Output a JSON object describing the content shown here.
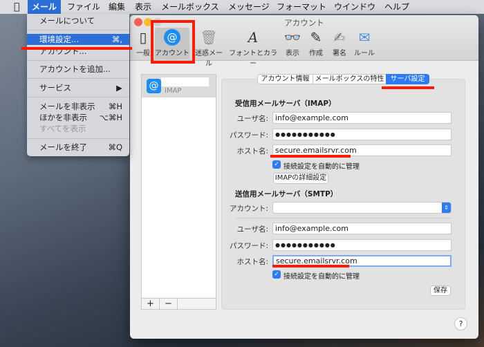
{
  "menubar": {
    "items": [
      "メール",
      "ファイル",
      "編集",
      "表示",
      "メールボックス",
      "メッセージ",
      "フォーマット",
      "ウインドウ",
      "ヘルプ"
    ]
  },
  "menu": {
    "items": [
      {
        "label": "メールについて",
        "shortcut": ""
      },
      {
        "label": "環境設定...",
        "shortcut": "⌘,"
      },
      {
        "label": "アカウント...",
        "shortcut": ""
      },
      {
        "label": "アカウントを追加...",
        "shortcut": ""
      },
      {
        "label": "サービス",
        "shortcut": "▶"
      },
      {
        "label": "メールを非表示",
        "shortcut": "⌘H"
      },
      {
        "label": "ほかを非表示",
        "shortcut": "⌥⌘H"
      },
      {
        "label": "すべてを表示",
        "shortcut": ""
      },
      {
        "label": "メールを終了",
        "shortcut": "⌘Q"
      }
    ]
  },
  "window": {
    "title": "アカウント",
    "toolbar": [
      "一般",
      "アカウント",
      "迷惑メール",
      "フォントとカラー",
      "表示",
      "作成",
      "署名",
      "ルール"
    ],
    "account_list": {
      "type": "IMAP",
      "add": "+",
      "remove": "−"
    },
    "tabs": [
      "アカウント情報",
      "メールボックスの特性",
      "サーバ設定"
    ],
    "incoming": {
      "heading": "受信用メールサーバ（IMAP）",
      "user_label": "ユーザ名:",
      "user": "info@example.com",
      "pass_label": "パスワード:",
      "pass": "●●●●●●●●●●●",
      "host_label": "ホスト名:",
      "host": "secure.emailsrvr.com",
      "auto": "接続設定を自動的に管理",
      "advanced": "IMAPの詳細設定"
    },
    "outgoing": {
      "heading": "送信用メールサーバ（SMTP）",
      "account_label": "アカウント:",
      "user_label": "ユーザ名:",
      "user": "info@example.com",
      "pass_label": "パスワード:",
      "pass": "●●●●●●●●●●●",
      "host_label": "ホスト名:",
      "host": "secure.emailsrvr.com",
      "auto": "接続設定を自動的に管理"
    },
    "save": "保存",
    "help": "?"
  },
  "colors": {
    "accent": "#2c6fd8",
    "annotation": "#ff1a00"
  }
}
